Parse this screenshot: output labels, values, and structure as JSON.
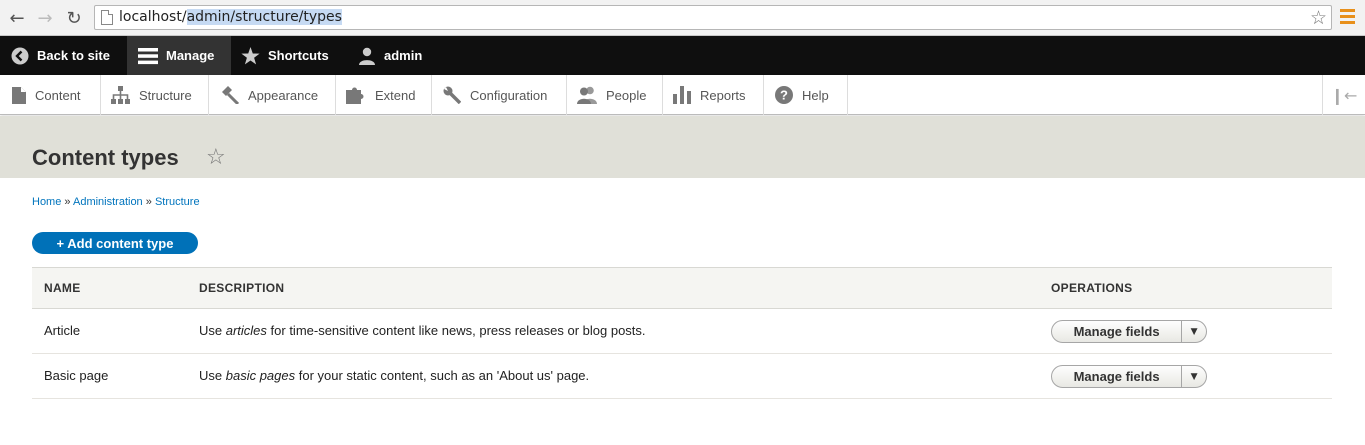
{
  "browser": {
    "url_host": "localhost/",
    "url_path": "admin/structure/types"
  },
  "toolbar": {
    "back": "Back to site",
    "manage": "Manage",
    "shortcuts": "Shortcuts",
    "user": "admin"
  },
  "tray": {
    "items": [
      "Content",
      "Structure",
      "Appearance",
      "Extend",
      "Configuration",
      "People",
      "Reports",
      "Help"
    ]
  },
  "page": {
    "title": "Content types"
  },
  "breadcrumb": {
    "items": [
      "Home",
      "Administration",
      "Structure"
    ],
    "separator": "»"
  },
  "actions": {
    "add": "+ Add content type"
  },
  "table": {
    "headers": [
      "NAME",
      "DESCRIPTION",
      "OPERATIONS"
    ],
    "rows": [
      {
        "name": "Article",
        "desc_pre": "Use ",
        "desc_em": "articles",
        "desc_post": " for time-sensitive content like news, press releases or blog posts.",
        "op": "Manage fields"
      },
      {
        "name": "Basic page",
        "desc_pre": "Use ",
        "desc_em": "basic pages",
        "desc_post": " for your static content, such as an 'About us' page.",
        "op": "Manage fields"
      }
    ]
  },
  "colors": {
    "toolbar_bg": "#0f0f0f",
    "primary_button": "#0071b8",
    "link": "#0074bd",
    "header_bg": "#e0e0d8"
  }
}
